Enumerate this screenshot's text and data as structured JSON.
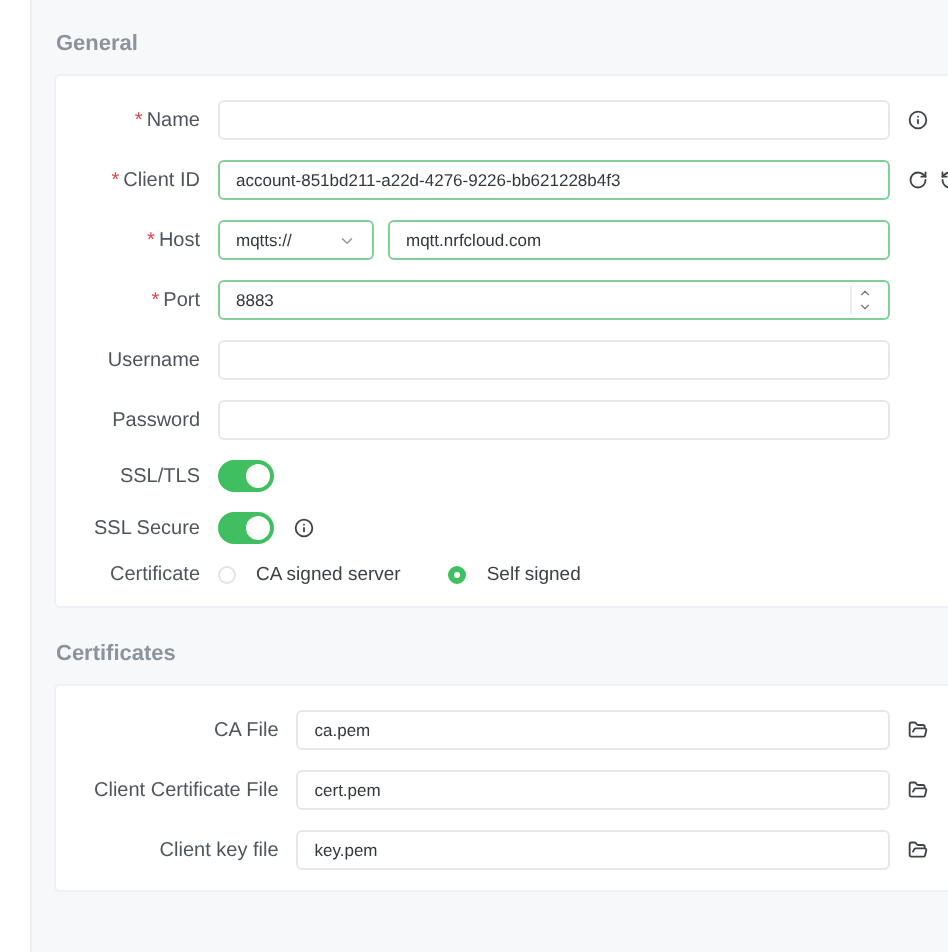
{
  "sections": [
    {
      "title": "General",
      "rows": [
        {
          "kind": "text",
          "label": "Name",
          "required_mark": "*",
          "value": "",
          "valid": false,
          "icons": [
            {
              "kind": "info"
            }
          ]
        },
        {
          "kind": "text",
          "label": "Client ID",
          "required_mark": "*",
          "value": "account-851bd211-a22d-4276-9226-bb621228b4f3",
          "valid": true,
          "icons": [
            {
              "kind": "refresh"
            },
            {
              "kind": "history"
            }
          ]
        },
        {
          "kind": "host",
          "label": "Host",
          "required_mark": "*",
          "protocol": "mqtts://",
          "value": "mqtt.nrfcloud.com",
          "valid": true
        },
        {
          "kind": "number",
          "label": "Port",
          "required_mark": "*",
          "value": "8883",
          "valid": true
        },
        {
          "kind": "text",
          "label": "Username",
          "value": "",
          "valid": false
        },
        {
          "kind": "text",
          "label": "Password",
          "value": "",
          "valid": false
        },
        {
          "kind": "switch",
          "label": "SSL/TLS",
          "on": true
        },
        {
          "kind": "switch",
          "label": "SSL Secure",
          "on": true,
          "icons": [
            {
              "kind": "info"
            }
          ]
        },
        {
          "kind": "radio",
          "label": "Certificate",
          "options": [
            {
              "label": "CA signed server",
              "selected": false
            },
            {
              "label": "Self signed",
              "selected": true
            }
          ]
        }
      ]
    },
    {
      "title": "Certificates",
      "rows": [
        {
          "kind": "text",
          "label": "CA File",
          "value": "ca.pem",
          "valid": false,
          "icons": [
            {
              "kind": "folder"
            }
          ]
        },
        {
          "kind": "text",
          "label": "Client Certificate File",
          "value": "cert.pem",
          "valid": false,
          "icons": [
            {
              "kind": "folder"
            }
          ]
        },
        {
          "kind": "text",
          "label": "Client key file",
          "value": "key.pem",
          "valid": false,
          "icons": [
            {
              "kind": "folder"
            }
          ]
        }
      ]
    }
  ]
}
